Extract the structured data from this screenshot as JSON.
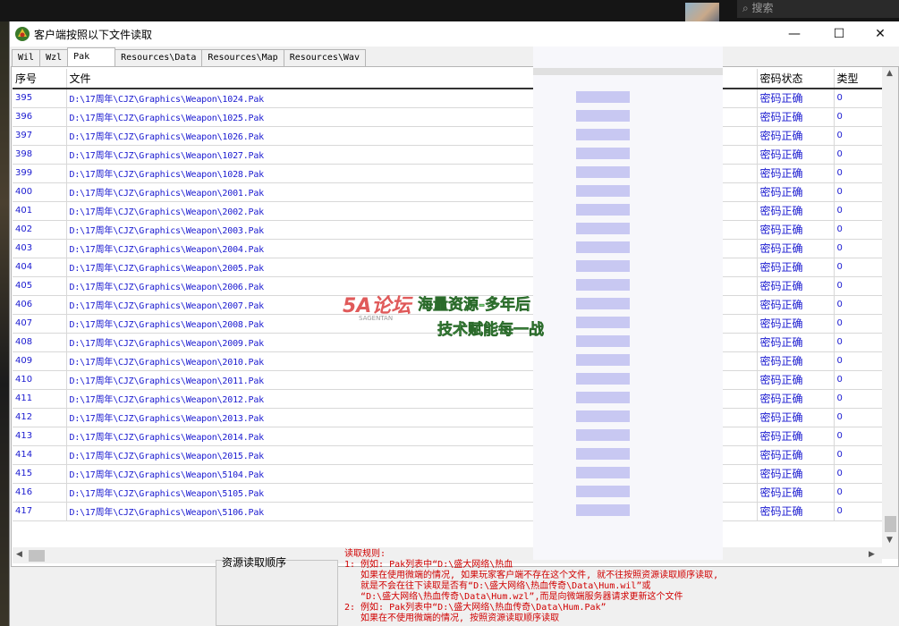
{
  "background": {
    "search_placeholder": "搜索"
  },
  "window": {
    "title": "客户端按照以下文件读取",
    "controls": {
      "minimize": "—",
      "maximize": "☐",
      "close": "✕"
    }
  },
  "tabs": [
    "Wil",
    "Wzl",
    "Pak",
    "Resources\\Data",
    "Resources\\Map",
    "Resources\\Wav"
  ],
  "active_tab": "Pak",
  "table": {
    "headers": {
      "seq": "序号",
      "file": "文件",
      "password_status": "密码状态",
      "type": "类型"
    },
    "rows": [
      {
        "seq": "395",
        "file": "D:\\17周年\\CJZ\\Graphics\\Weapon\\1024.Pak",
        "status": "密码正确",
        "type": "0"
      },
      {
        "seq": "396",
        "file": "D:\\17周年\\CJZ\\Graphics\\Weapon\\1025.Pak",
        "status": "密码正确",
        "type": "0"
      },
      {
        "seq": "397",
        "file": "D:\\17周年\\CJZ\\Graphics\\Weapon\\1026.Pak",
        "status": "密码正确",
        "type": "0"
      },
      {
        "seq": "398",
        "file": "D:\\17周年\\CJZ\\Graphics\\Weapon\\1027.Pak",
        "status": "密码正确",
        "type": "0"
      },
      {
        "seq": "399",
        "file": "D:\\17周年\\CJZ\\Graphics\\Weapon\\1028.Pak",
        "status": "密码正确",
        "type": "0"
      },
      {
        "seq": "400",
        "file": "D:\\17周年\\CJZ\\Graphics\\Weapon\\2001.Pak",
        "status": "密码正确",
        "type": "0"
      },
      {
        "seq": "401",
        "file": "D:\\17周年\\CJZ\\Graphics\\Weapon\\2002.Pak",
        "status": "密码正确",
        "type": "0"
      },
      {
        "seq": "402",
        "file": "D:\\17周年\\CJZ\\Graphics\\Weapon\\2003.Pak",
        "status": "密码正确",
        "type": "0"
      },
      {
        "seq": "403",
        "file": "D:\\17周年\\CJZ\\Graphics\\Weapon\\2004.Pak",
        "status": "密码正确",
        "type": "0"
      },
      {
        "seq": "404",
        "file": "D:\\17周年\\CJZ\\Graphics\\Weapon\\2005.Pak",
        "status": "密码正确",
        "type": "0"
      },
      {
        "seq": "405",
        "file": "D:\\17周年\\CJZ\\Graphics\\Weapon\\2006.Pak",
        "status": "密码正确",
        "type": "0"
      },
      {
        "seq": "406",
        "file": "D:\\17周年\\CJZ\\Graphics\\Weapon\\2007.Pak",
        "status": "密码正确",
        "type": "0"
      },
      {
        "seq": "407",
        "file": "D:\\17周年\\CJZ\\Graphics\\Weapon\\2008.Pak",
        "status": "密码正确",
        "type": "0"
      },
      {
        "seq": "408",
        "file": "D:\\17周年\\CJZ\\Graphics\\Weapon\\2009.Pak",
        "status": "密码正确",
        "type": "0"
      },
      {
        "seq": "409",
        "file": "D:\\17周年\\CJZ\\Graphics\\Weapon\\2010.Pak",
        "status": "密码正确",
        "type": "0"
      },
      {
        "seq": "410",
        "file": "D:\\17周年\\CJZ\\Graphics\\Weapon\\2011.Pak",
        "status": "密码正确",
        "type": "0"
      },
      {
        "seq": "411",
        "file": "D:\\17周年\\CJZ\\Graphics\\Weapon\\2012.Pak",
        "status": "密码正确",
        "type": "0"
      },
      {
        "seq": "412",
        "file": "D:\\17周年\\CJZ\\Graphics\\Weapon\\2013.Pak",
        "status": "密码正确",
        "type": "0"
      },
      {
        "seq": "413",
        "file": "D:\\17周年\\CJZ\\Graphics\\Weapon\\2014.Pak",
        "status": "密码正确",
        "type": "0"
      },
      {
        "seq": "414",
        "file": "D:\\17周年\\CJZ\\Graphics\\Weapon\\2015.Pak",
        "status": "密码正确",
        "type": "0"
      },
      {
        "seq": "415",
        "file": "D:\\17周年\\CJZ\\Graphics\\Weapon\\5104.Pak",
        "status": "密码正确",
        "type": "0"
      },
      {
        "seq": "416",
        "file": "D:\\17周年\\CJZ\\Graphics\\Weapon\\5105.Pak",
        "status": "密码正确",
        "type": "0"
      },
      {
        "seq": "417",
        "file": "D:\\17周年\\CJZ\\Graphics\\Weapon\\5106.Pak",
        "status": "密码正确",
        "type": "0"
      }
    ]
  },
  "bottom": {
    "order_label": "资源读取顺序",
    "rules": [
      "读取规则:",
      "1: 例如: Pak列表中“D:\\盛大网络\\热血",
      "   如果在使用微端的情况, 如果玩家客户端不存在这个文件, 就不往按照资源读取顺序读取,",
      "   就是不会在往下读取是否有“D:\\盛大网络\\热血传奇\\Data\\Hum.wil”或",
      "   “D:\\盛大网络\\热血传奇\\Data\\Hum.wzl”,而是向微端服务器请求更新这个文件",
      "2: 例如: Pak列表中“D:\\盛大网络\\热血传奇\\Data\\Hum.Pak”",
      "   如果在不使用微端的情况, 按照资源读取顺序读取"
    ]
  },
  "watermark": {
    "logo": "5A论坛",
    "sub": "SAGENTAN",
    "line1": "海量资源-多年后",
    "line2": "技术赋能每一战"
  },
  "colors": {
    "accent_text": "#1a1ad0",
    "rules_text": "#d00000"
  }
}
